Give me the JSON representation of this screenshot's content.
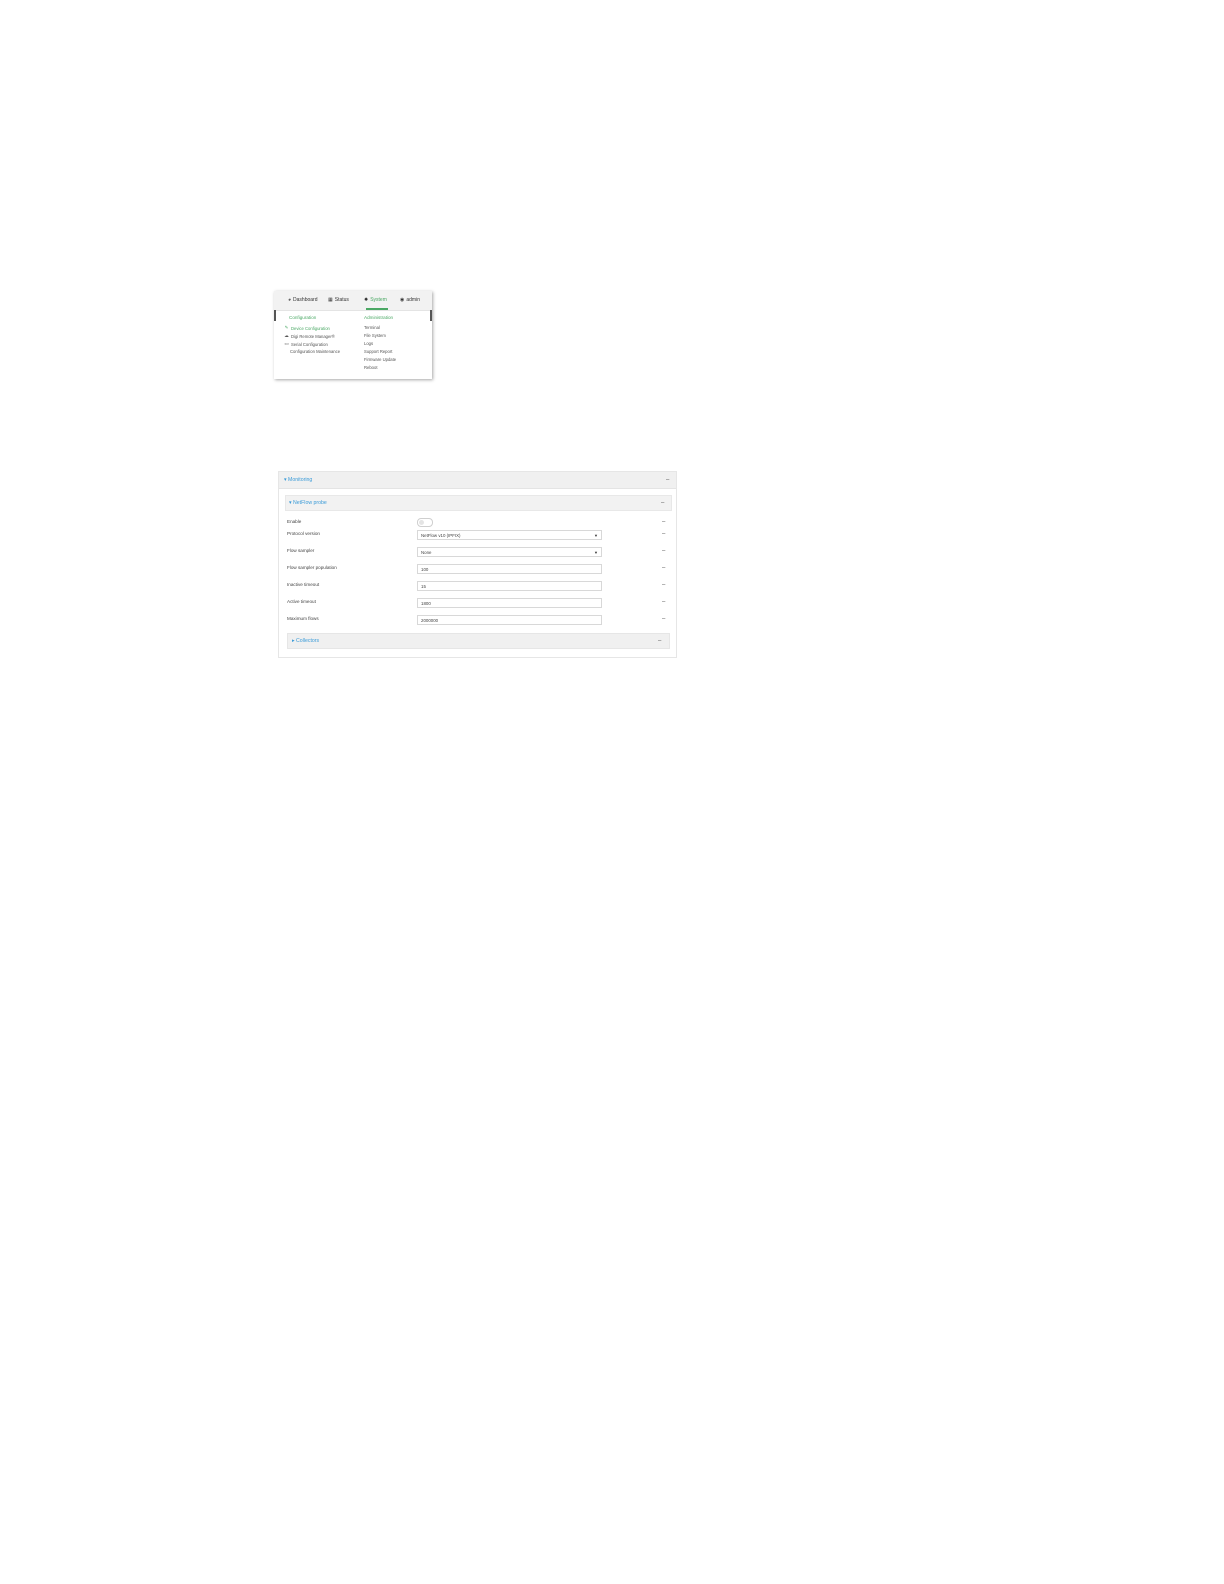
{
  "menu": {
    "nav": {
      "dashboard": "Dashboard",
      "status": "Status",
      "system": "System",
      "admin": "admin"
    },
    "configuration_heading": "Configuration",
    "administration_heading": "Administration",
    "configuration_items": [
      {
        "label": "Device Configuration",
        "icon": "wrench-icon"
      },
      {
        "label": "Digi Remote Manager®",
        "icon": "cloud-icon"
      },
      {
        "label": "Serial Configuration",
        "icon": "serial-icon"
      },
      {
        "label": "Configuration Maintenance",
        "icon": ""
      }
    ],
    "administration_items": [
      "Terminal",
      "File System",
      "Logs",
      "Support Report",
      "Firmware Update",
      "Reboot"
    ]
  },
  "panel": {
    "monitoring_title": "▾ Monitoring",
    "netflow_title": "▾ NetFlow probe",
    "fields": {
      "enable": {
        "label": "Enable",
        "value": false
      },
      "protocol_version": {
        "label": "Protocol version",
        "value": "NetFlow v10 (IPFIX)"
      },
      "flow_sampler": {
        "label": "Flow sampler",
        "value": "None"
      },
      "flow_sampler_population": {
        "label": "Flow sampler population",
        "value": "100"
      },
      "inactive_timeout": {
        "label": "Inactive timeout",
        "value": "15"
      },
      "active_timeout": {
        "label": "Active timeout",
        "value": "1800"
      },
      "maximum_flows": {
        "label": "Maximum flows",
        "value": "2000000"
      }
    },
    "collectors_title": "▸ Collectors"
  }
}
